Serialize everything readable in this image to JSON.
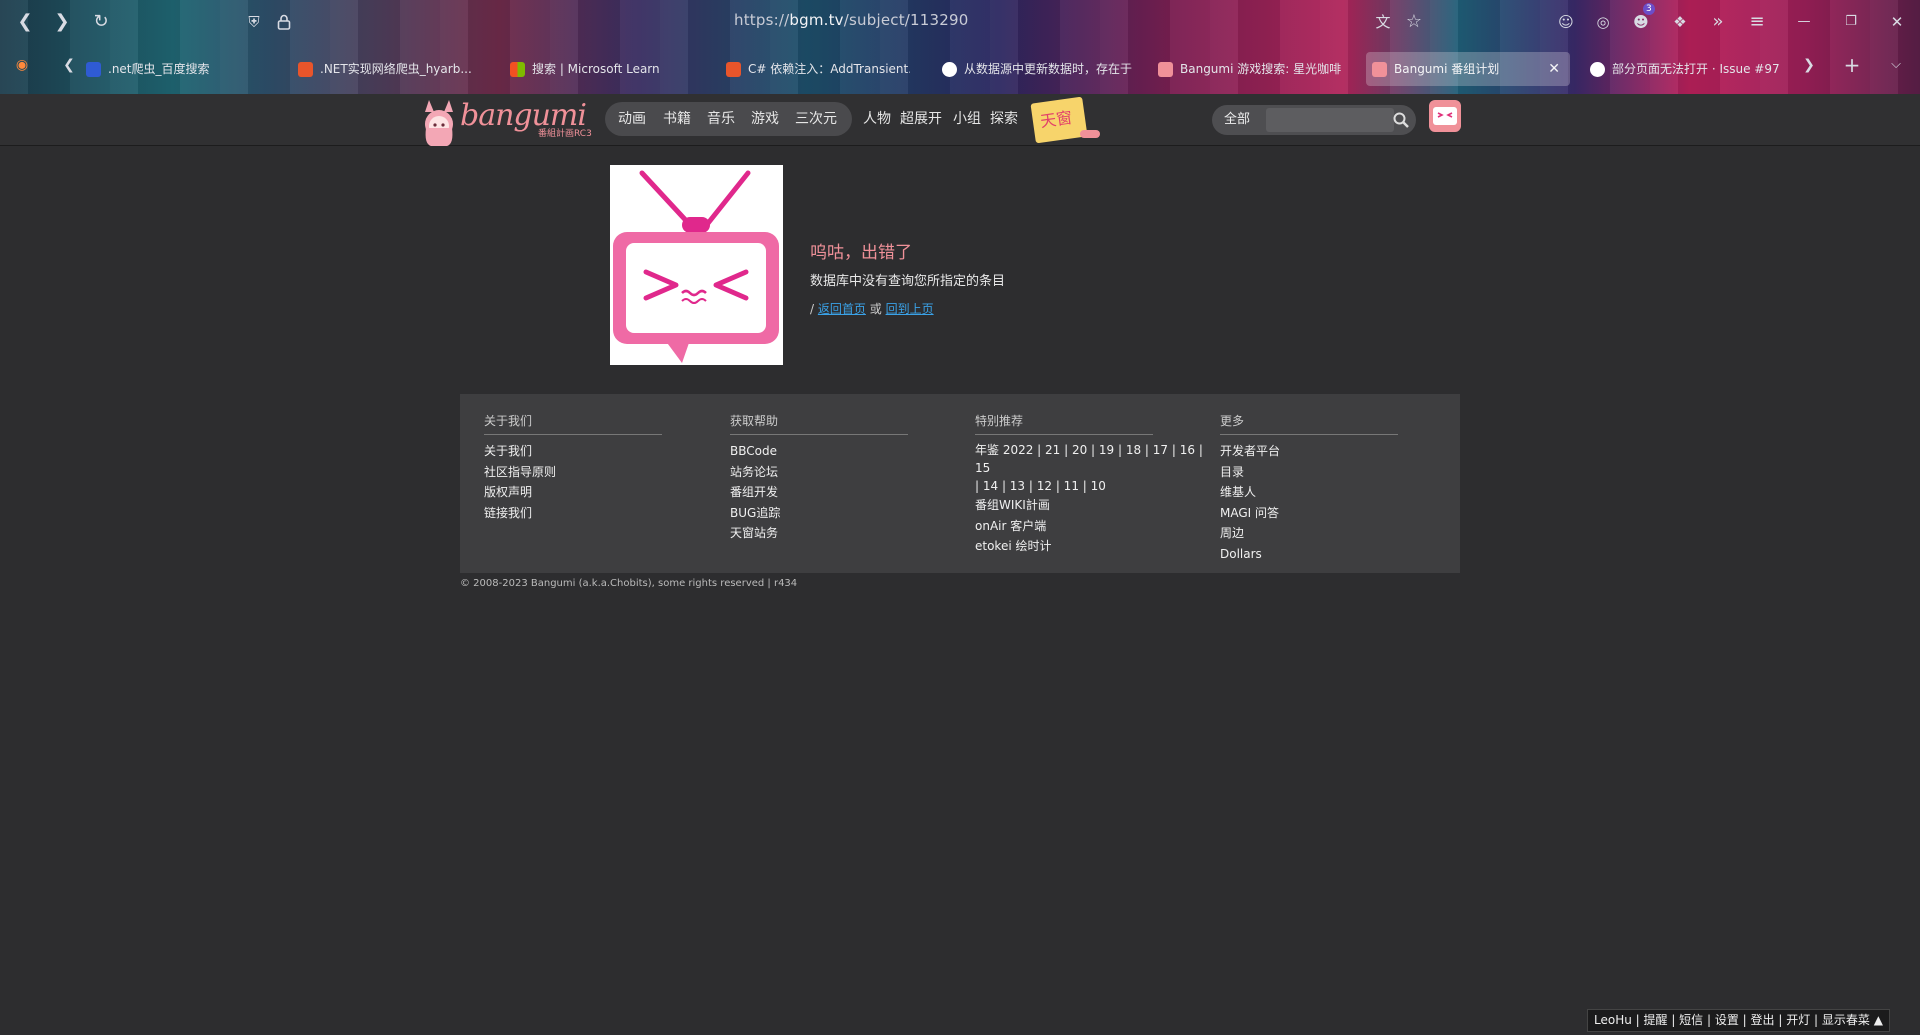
{
  "browser": {
    "url_prefix": "https://",
    "url_host": "bgm.tv",
    "url_path": "/subject/113290",
    "tabs": [
      {
        "title": ".net爬虫_百度搜索",
        "color": "#2f5bd3"
      },
      {
        "title": ".NET实现网络爬虫_hyarb...",
        "color": "#e8552b"
      },
      {
        "title": "搜索 | Microsoft Learn",
        "color": "#7fba00"
      },
      {
        "title": "C# 依赖注入：AddTransient...",
        "color": "#e8552b"
      },
      {
        "title": "从数据源中更新数据时，存在于...",
        "color": "#ffffff"
      },
      {
        "title": "Bangumi 游戏搜索: 星光咖啡...",
        "color": "#f09199"
      },
      {
        "title": "Bangumi 番组计划",
        "color": "#f09199"
      },
      {
        "title": "部分页面无法打开 · Issue #97",
        "color": "#ffffff"
      }
    ],
    "badge_count": "3"
  },
  "header": {
    "logo": "bangumi",
    "logo_sub": "番組計画RC3",
    "nav": [
      "动画",
      "书籍",
      "音乐",
      "游戏",
      "三次元"
    ],
    "nav2": [
      "人物",
      "超展开",
      "小组",
      "探索"
    ],
    "sticker": "天窗",
    "search_category": "全部",
    "search_placeholder": ""
  },
  "error": {
    "title": "呜咕，出错了",
    "message": "数据库中没有查询您所指定的条目",
    "prefix": "/",
    "home_link": "返回首页",
    "or": "或",
    "back_link": "回到上页"
  },
  "footer": {
    "cols": [
      {
        "title": "关于我们",
        "links": [
          "关于我们",
          "社区指导原则",
          "版权声明",
          "链接我们"
        ]
      },
      {
        "title": "获取帮助",
        "links": [
          "BBCode",
          "站务论坛",
          "番组开发",
          "BUG追踪",
          "天窗站务"
        ]
      },
      {
        "title": "特别推荐",
        "years1": "年鉴 2022 | 21 | 20 | 19 | 18 | 17 | 16 | 15",
        "years2": "| 14 | 13 | 12 | 11 | 10",
        "links": [
          "番组WIKI計画",
          "onAir 客户端",
          "etokei 绘时计"
        ]
      },
      {
        "title": "更多",
        "links": [
          "开发者平台",
          "目录",
          "维基人",
          "MAGI 问答",
          "周边",
          "Dollars"
        ]
      }
    ],
    "copyright": "© 2008-2023 Bangumi (a.k.a.Chobits), some rights reserved | r434"
  },
  "bottom_bar": {
    "user": "LeoHu",
    "links": "| 提醒 | 短信 | 设置 | 登出 | 开灯 | 显示春菜 ▲"
  }
}
